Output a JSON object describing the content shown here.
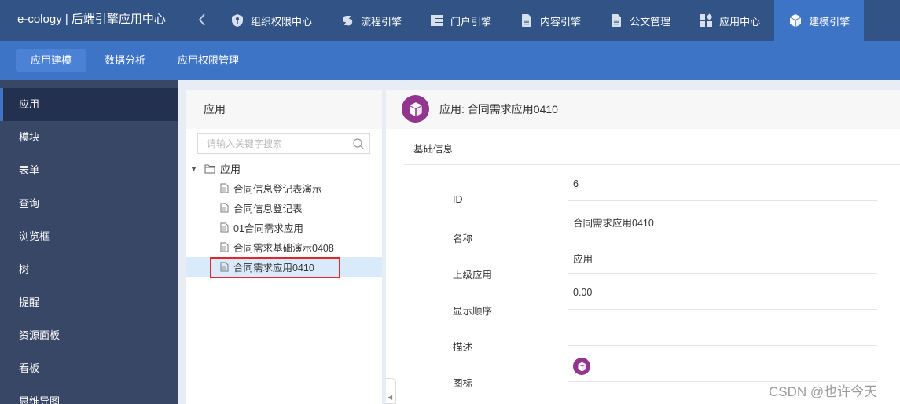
{
  "header": {
    "brand": "e-cology | 后端引擎应用中心",
    "back_icon": "chevron-left-icon",
    "nav": [
      {
        "label": "组织权限中心",
        "icon": "shield-key-icon",
        "active": false
      },
      {
        "label": "流程引擎",
        "icon": "workflow-icon",
        "active": false
      },
      {
        "label": "门户引擎",
        "icon": "portal-layout-icon",
        "active": false
      },
      {
        "label": "内容引擎",
        "icon": "document-icon",
        "active": false
      },
      {
        "label": "公文管理",
        "icon": "document-icon",
        "active": false
      },
      {
        "label": "应用中心",
        "icon": "app-grid-icon",
        "active": false
      },
      {
        "label": "建模引擎",
        "icon": "cube-icon",
        "active": true
      }
    ]
  },
  "subnav": {
    "tabs": [
      {
        "label": "应用建模",
        "active": true
      },
      {
        "label": "数据分析",
        "active": false
      },
      {
        "label": "应用权限管理",
        "active": false
      }
    ]
  },
  "sidebar": {
    "items": [
      {
        "label": "应用",
        "active": true
      },
      {
        "label": "模块",
        "active": false
      },
      {
        "label": "表单",
        "active": false
      },
      {
        "label": "查询",
        "active": false
      },
      {
        "label": "浏览框",
        "active": false
      },
      {
        "label": "树",
        "active": false
      },
      {
        "label": "提醒",
        "active": false
      },
      {
        "label": "资源面板",
        "active": false
      },
      {
        "label": "看板",
        "active": false
      },
      {
        "label": "思维导图",
        "active": false
      }
    ]
  },
  "tree_panel": {
    "title": "应用",
    "search_placeholder": "请输入关键字搜索",
    "search_value": "",
    "root": {
      "label": "应用",
      "expanded": true
    },
    "nodes": [
      {
        "label": "合同信息登记表演示",
        "selected": false
      },
      {
        "label": "合同信息登记表",
        "selected": false
      },
      {
        "label": "01合同需求应用",
        "selected": false
      },
      {
        "label": "合同需求基础演示0408",
        "selected": false
      },
      {
        "label": "合同需求应用0410",
        "selected": true
      }
    ]
  },
  "detail": {
    "title": "应用: 合同需求应用0410",
    "icon_color": "#91358f",
    "section": "基础信息",
    "fields": [
      {
        "label": "ID",
        "value": "6"
      },
      {
        "label": "名称",
        "value": "合同需求应用0410"
      },
      {
        "label": "上级应用",
        "value": "应用"
      },
      {
        "label": "显示顺序",
        "value": "0.00"
      },
      {
        "label": "描述",
        "value": ""
      },
      {
        "label": "图标",
        "value": "cube-icon"
      }
    ]
  },
  "colors": {
    "topbar": "#325386",
    "accent": "#3e74c6",
    "sidebar": "#394766",
    "sidebar_active": "#23304f",
    "selection_highlight": "#e0252b",
    "app_icon": "#91358f"
  },
  "watermark": "CSDN @也许今天"
}
